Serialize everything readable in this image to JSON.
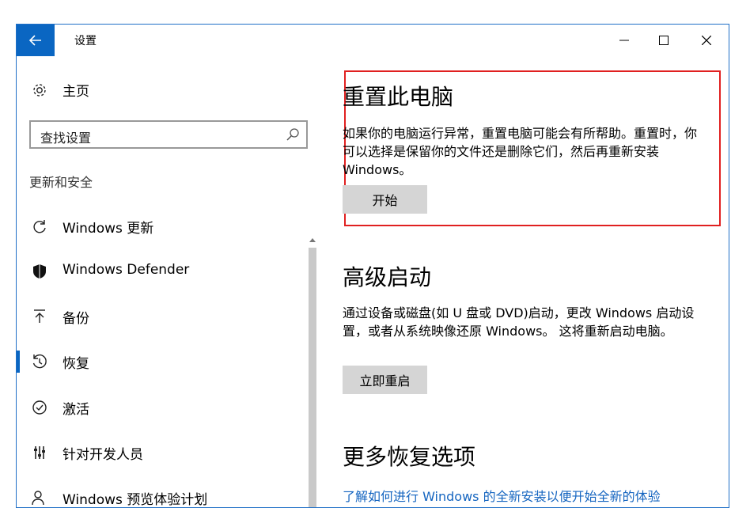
{
  "window": {
    "title": "设置",
    "back_icon": "back-arrow-icon",
    "controls": [
      "minimize-icon",
      "maximize-icon",
      "close-icon"
    ],
    "accent_color": "#0a66c2"
  },
  "sidebar": {
    "home_label": "主页",
    "search": {
      "value": "查找设置"
    },
    "section_title": "更新和安全",
    "items": [
      {
        "label": "Windows 更新",
        "icon": "refresh-icon"
      },
      {
        "label": "Windows Defender",
        "icon": "shield-icon"
      },
      {
        "label": "备份",
        "icon": "backup-icon"
      },
      {
        "label": "恢复",
        "icon": "recovery-icon",
        "active": true
      },
      {
        "label": "激活",
        "icon": "check-circle-icon"
      },
      {
        "label": "针对开发人员",
        "icon": "developer-icon"
      },
      {
        "label": "Windows 预览体验计划",
        "icon": "insider-icon"
      }
    ]
  },
  "main": {
    "reset": {
      "heading": "重置此电脑",
      "description": "如果你的电脑运行异常，重置电脑可能会有所帮助。重置时，你可以选择是保留你的文件还是删除它们，然后再重新安装 Windows。",
      "button": "开始",
      "highlight_color": "#e02020"
    },
    "advanced": {
      "heading": "高级启动",
      "description": "通过设备或磁盘(如 U 盘或 DVD)启动，更改 Windows 启动设置，或者从系统映像还原 Windows。 这将重新启动电脑。",
      "button": "立即重启"
    },
    "more": {
      "heading": "更多恢复选项",
      "link": "了解如何进行 Windows 的全新安装以便开始全新的体验"
    }
  }
}
